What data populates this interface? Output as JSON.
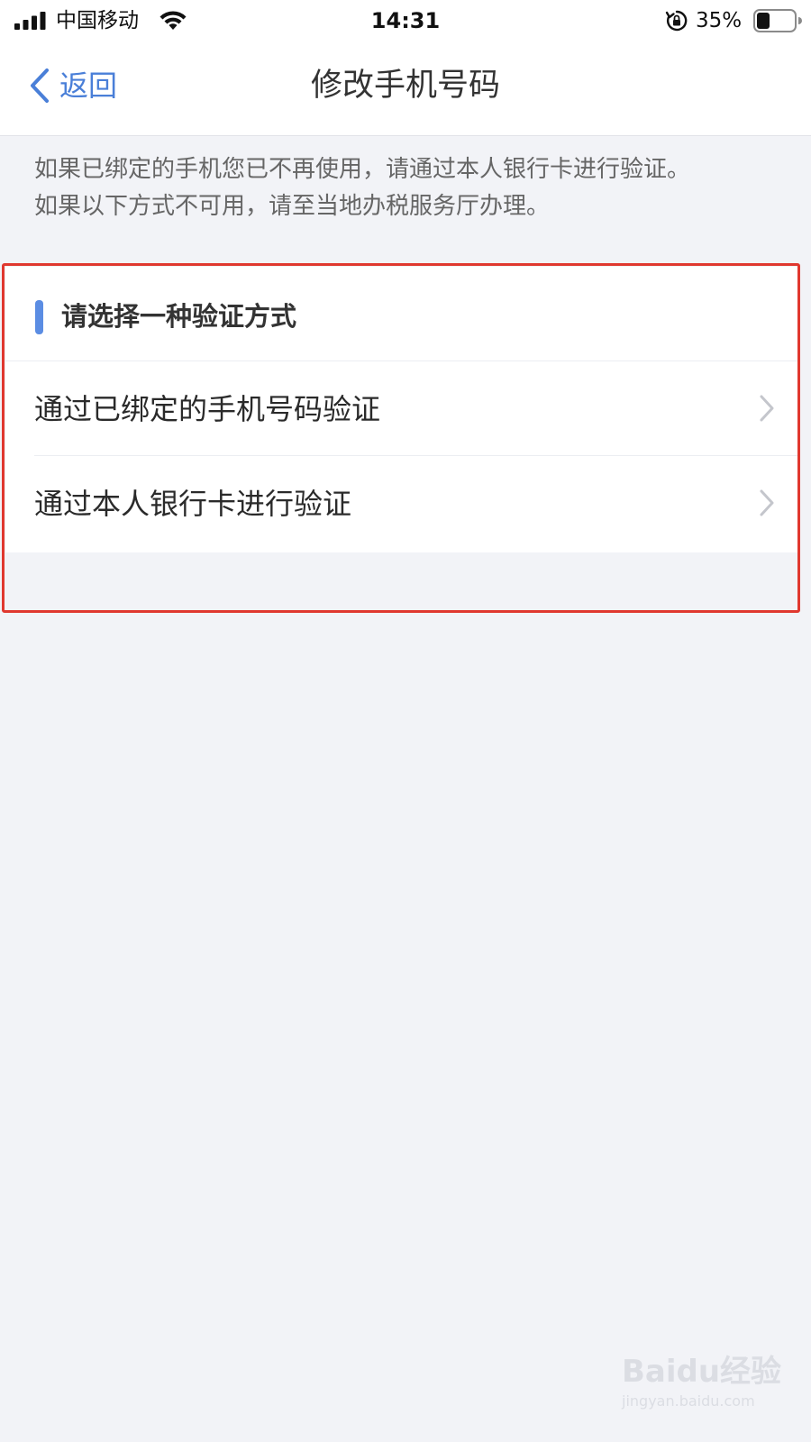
{
  "status_bar": {
    "carrier": "中国移动",
    "time": "14:31",
    "battery_percent": "35%",
    "battery_level": 0.35,
    "icons": [
      "signal-icon",
      "wifi-icon",
      "rotation-lock-icon",
      "battery-icon"
    ]
  },
  "nav": {
    "back_label": "返回",
    "title": "修改手机号码",
    "back_icon": "chevron-left-icon"
  },
  "hint": {
    "lines": [
      "如果已绑定的手机您已不再使用，请通过本人银行卡进行验证。",
      "如果以下方式不可用，请至当地办税服务厅办理。"
    ]
  },
  "verification": {
    "section_title": "请选择一种验证方式",
    "options": [
      {
        "label": "通过已绑定的手机号码验证",
        "icon": "chevron-right-icon"
      },
      {
        "label": "通过本人银行卡进行验证",
        "icon": "chevron-right-icon"
      }
    ]
  },
  "watermark": {
    "brand": "Baidu经验",
    "url": "jingyan.baidu.com"
  },
  "colors": {
    "accent": "#4a7fd8",
    "section_accent": "#5b8de3",
    "highlight": "#e0382f",
    "background": "#f2f3f7"
  }
}
